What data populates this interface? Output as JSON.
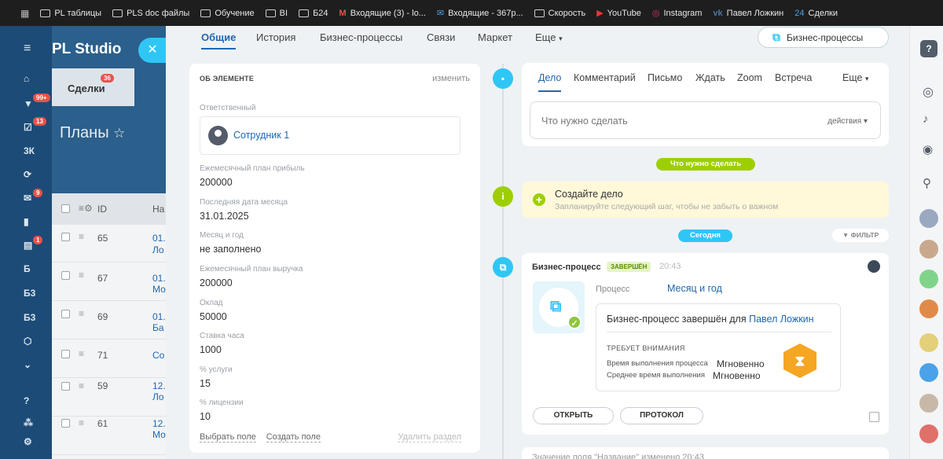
{
  "bookmarks": [
    {
      "label": "PL таблицы",
      "icon": "folder-icon"
    },
    {
      "label": "PLS doc файлы",
      "icon": "folder-icon"
    },
    {
      "label": "Обучение",
      "icon": "folder-icon"
    },
    {
      "label": "BI",
      "icon": "folder-icon"
    },
    {
      "label": "Б24",
      "icon": "folder-icon"
    },
    {
      "label": "Входящие (3) - lo...",
      "icon": "gmail-icon"
    },
    {
      "label": "Входящие - 367р...",
      "icon": "mail-icon"
    },
    {
      "label": "Скорость",
      "icon": "folder-icon"
    },
    {
      "label": "YouTube",
      "icon": "youtube-icon"
    },
    {
      "label": "Instagram",
      "icon": "instagram-icon"
    },
    {
      "label": "Павел Ложкин",
      "icon": "vk-icon"
    },
    {
      "label": "Сделки",
      "icon": "bitrix-icon"
    }
  ],
  "app": {
    "title": "PL Studio",
    "deal_tab": "Сделки",
    "deal_count": "36",
    "page_title": "Планы"
  },
  "left_nav": {
    "badge_filter": "99+",
    "badge_tasks": "13",
    "label_3k": "3К",
    "badge_mail": "9",
    "badge_docs": "1",
    "label_b": "Б",
    "label_bz1": "Б3",
    "label_bz2": "Б3"
  },
  "grid": {
    "header_id": "ID",
    "header_name": "На",
    "rows": [
      {
        "id": "65",
        "name": "01.",
        "name2": "Ло"
      },
      {
        "id": "67",
        "name": "01.",
        "name2": "Мо"
      },
      {
        "id": "69",
        "name": "01.",
        "name2": "Ба"
      },
      {
        "id": "71",
        "name": "Со",
        "name2": ""
      },
      {
        "id": "59",
        "name": "12.",
        "name2": "Ло"
      },
      {
        "id": "61",
        "name": "12.",
        "name2": "Мо"
      }
    ]
  },
  "tabs": [
    "Общие",
    "История",
    "Бизнес-процессы",
    "Связи",
    "Маркет",
    "Еще"
  ],
  "bp_button": "Бизнес-процессы",
  "about": {
    "heading": "ОБ ЭЛЕМЕНТЕ",
    "edit": "изменить",
    "responsible_label": "Ответственный",
    "responsible_value": "Сотрудник 1",
    "fields": [
      {
        "label": "Ежемесячный план прибыль",
        "value": "200000"
      },
      {
        "label": "Последняя дата месяца",
        "value": "31.01.2025"
      },
      {
        "label": "Месяц и год",
        "value": "не заполнено"
      },
      {
        "label": "Ежемесячный план выручка",
        "value": "200000"
      },
      {
        "label": "Оклад",
        "value": "50000"
      },
      {
        "label": "Ставка часа",
        "value": "1000"
      },
      {
        "label": "% услуги",
        "value": "15"
      },
      {
        "label": "% лицензии",
        "value": "10"
      }
    ],
    "select_field": "Выбрать поле",
    "create_field": "Создать поле",
    "delete_section": "Удалить раздел"
  },
  "editor": {
    "tabs": [
      "Дело",
      "Комментарий",
      "Письмо",
      "Ждать",
      "Zoom",
      "Встреча",
      "Еще"
    ],
    "placeholder": "Что нужно сделать",
    "actions": "действия"
  },
  "pill_todo": "Что нужно сделать",
  "create_task": {
    "title": "Создайте дело",
    "subtitle": "Запланируйте следующий шаг, чтобы не забыть о важном"
  },
  "pill_today": "Сегодня",
  "filter": "ФИЛЬТР",
  "bp_card": {
    "header": "Бизнес-процесс",
    "status": "ЗАВЕРШЁН",
    "time": "20:43",
    "process_label": "Процесс",
    "process_value": "Месяц и год",
    "done_text": "Бизнес-процесс завершён для",
    "done_user": "Павел Ложкин",
    "attention": "ТРЕБУЕТ ВНИМАНИЯ",
    "exec_time_label": "Время выполнения процесса",
    "exec_time_value": "Мгновенно",
    "avg_time_label": "Среднее время выполнения",
    "avg_time_value": "Мгновенно",
    "open_btn": "ОТКРЫТЬ",
    "protocol_btn": "ПРОТОКОЛ"
  },
  "last_event": "Значение поля \"Название\" изменено  20:43",
  "colors": {
    "accent": "#2067b0",
    "cyan": "#2fc6f6",
    "green": "#9dcf00",
    "nav": "#1c4b77"
  }
}
